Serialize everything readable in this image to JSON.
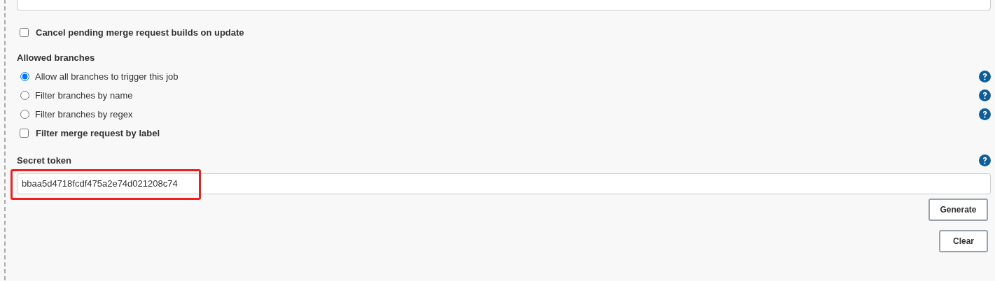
{
  "cancel_pending": {
    "label": "Cancel pending merge request builds on update",
    "checked": false
  },
  "allowed_branches": {
    "title": "Allowed branches",
    "options": [
      {
        "kind": "radio",
        "label": "Allow all branches to trigger this job",
        "selected": true,
        "help": true
      },
      {
        "kind": "radio",
        "label": "Filter branches by name",
        "selected": false,
        "help": true
      },
      {
        "kind": "radio",
        "label": "Filter branches by regex",
        "selected": false,
        "help": true
      },
      {
        "kind": "checkbox",
        "label": "Filter merge request by label",
        "checked": false
      }
    ]
  },
  "secret_token": {
    "label": "Secret token",
    "value": "bbaa5d4718fcdf475a2e74d021208c74",
    "help": true,
    "highlighted": true
  },
  "buttons": [
    "Generate",
    "Clear"
  ]
}
